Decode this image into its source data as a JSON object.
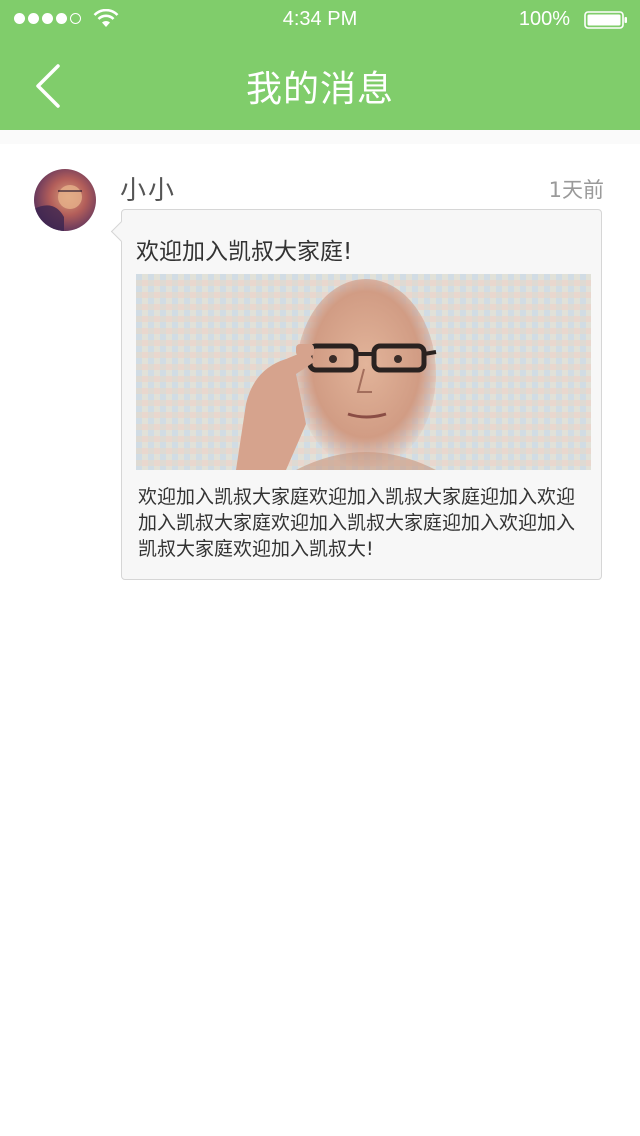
{
  "status_bar": {
    "time": "4:34 PM",
    "battery": "100%",
    "signal_icon": "signal-dots-icon",
    "wifi_icon": "wifi-icon",
    "battery_icon": "battery-icon"
  },
  "nav": {
    "title": "我的消息",
    "back_icon": "chevron-left-icon"
  },
  "colors": {
    "header": "#80cd6b",
    "bubble_bg": "#f7f7f7",
    "bubble_border": "#d6d6d6"
  },
  "message": {
    "sender": "小小",
    "time_ago": "1天前",
    "title": "欢迎加入凯叔大家庭!",
    "body": "欢迎加入凯叔大家庭欢迎加入凯叔大家庭迎加入欢迎加入凯叔大家庭欢迎加入凯叔大家庭迎加入欢迎加入凯叔大家庭欢迎加入凯叔大!"
  }
}
